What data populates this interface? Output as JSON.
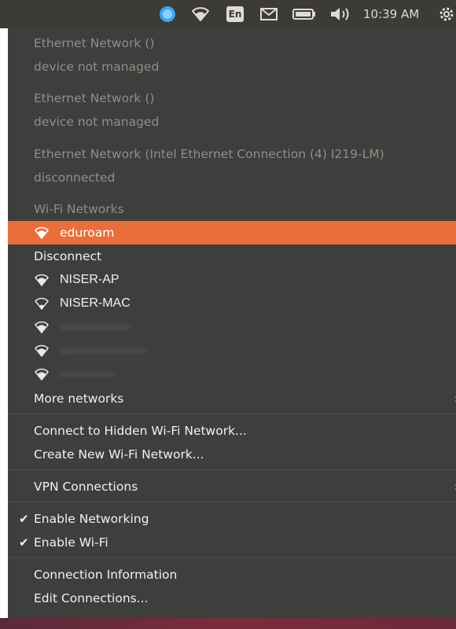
{
  "panel": {
    "clock": "10:39 AM",
    "keyboard_label": "En",
    "icons": [
      "skype-icon",
      "wifi-icon",
      "keyboard-layout-icon",
      "mail-icon",
      "battery-icon",
      "volume-icon",
      "settings-gear-icon"
    ]
  },
  "menu": {
    "ethernet": [
      {
        "name": "Ethernet Network ()",
        "status": "device not managed"
      },
      {
        "name": "Ethernet Network ()",
        "status": "device not managed"
      },
      {
        "name": "Ethernet Network (Intel Ethernet Connection (4) I219-LM)",
        "status": "disconnected"
      }
    ],
    "wifi_header": "Wi-Fi Networks",
    "connected_network": "eduroam",
    "disconnect_label": "Disconnect",
    "networks": [
      "NISER-AP",
      "NISER-MAC"
    ],
    "more_networks": "More networks",
    "connect_hidden": "Connect to Hidden Wi-Fi Network...",
    "create_new": "Create New Wi-Fi Network...",
    "vpn": "VPN Connections",
    "enable_networking": "Enable Networking",
    "enable_wifi": "Enable Wi-Fi",
    "connection_info": "Connection Information",
    "edit_connections": "Edit Connections...",
    "arrow_glyph": "›",
    "check_glyph": "✔"
  },
  "colors": {
    "panel": "#3c3b37",
    "menu_bg": "#3e3e3c",
    "highlight": "#e96e3c",
    "text": "#f2f1ef",
    "dim_text": "#8f8e8a"
  }
}
